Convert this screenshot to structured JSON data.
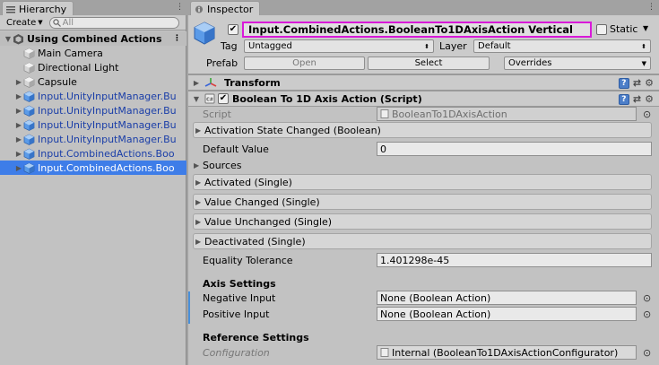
{
  "hierarchy": {
    "tab_label": "Hierarchy",
    "create_label": "Create",
    "search_placeholder": "All",
    "scene_name": "Using Combined Actions",
    "items": [
      {
        "label": "Main Camera",
        "prefab": false,
        "foldout": false,
        "selected": false
      },
      {
        "label": "Directional Light",
        "prefab": false,
        "foldout": false,
        "selected": false
      },
      {
        "label": "Capsule",
        "prefab": false,
        "foldout": true,
        "selected": false
      },
      {
        "label": "Input.UnityInputManager.Bu",
        "prefab": true,
        "foldout": true,
        "selected": false
      },
      {
        "label": "Input.UnityInputManager.Bu",
        "prefab": true,
        "foldout": true,
        "selected": false
      },
      {
        "label": "Input.UnityInputManager.Bu",
        "prefab": true,
        "foldout": true,
        "selected": false
      },
      {
        "label": "Input.UnityInputManager.Bu",
        "prefab": true,
        "foldout": true,
        "selected": false
      },
      {
        "label": "Input.CombinedActions.Boo",
        "prefab": true,
        "foldout": true,
        "selected": false
      },
      {
        "label": "Input.CombinedActions.Boo",
        "prefab": true,
        "foldout": true,
        "selected": true
      }
    ]
  },
  "inspector": {
    "tab_label": "Inspector",
    "object_name": "Input.CombinedActions.BooleanTo1DAxisAction Vertical",
    "static_label": "Static",
    "tag_label": "Tag",
    "tag_value": "Untagged",
    "layer_label": "Layer",
    "layer_value": "Default",
    "prefab_label": "Prefab",
    "open_label": "Open",
    "select_label": "Select",
    "overrides_label": "Overrides",
    "transform_label": "Transform",
    "component_label": "Boolean To 1D Axis Action (Script)",
    "script_label": "Script",
    "script_value": "BooleanTo1DAxisAction",
    "activation_event": "Activation State Changed (Boolean)",
    "default_value_label": "Default Value",
    "default_value": "0",
    "sources_label": "Sources",
    "events": [
      "Activated (Single)",
      "Value Changed (Single)",
      "Value Unchanged (Single)",
      "Deactivated (Single)"
    ],
    "equality_label": "Equality Tolerance",
    "equality_value": "1.401298e-45",
    "axis_settings_label": "Axis Settings",
    "negative_label": "Negative Input",
    "negative_value": "None (Boolean Action)",
    "positive_label": "Positive Input",
    "positive_value": "None (Boolean Action)",
    "reference_settings_label": "Reference Settings",
    "configuration_label": "Configuration",
    "configuration_value": "Internal (BooleanTo1DAxisActionConfigurator)"
  },
  "colors": {
    "selection": "#3e7de8",
    "highlight_border": "#d91ad9",
    "prefab_text": "#1a3ea8"
  }
}
